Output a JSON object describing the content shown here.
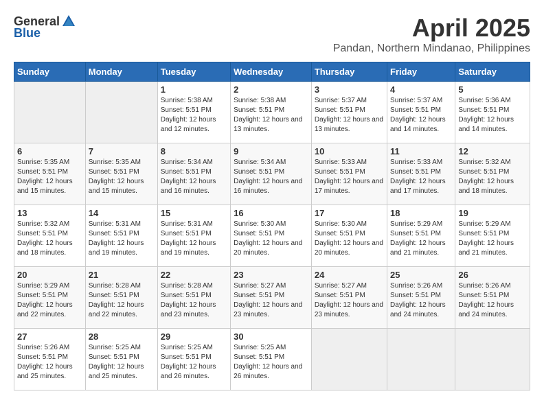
{
  "header": {
    "logo_general": "General",
    "logo_blue": "Blue",
    "month_year": "April 2025",
    "location": "Pandan, Northern Mindanao, Philippines"
  },
  "days_of_week": [
    "Sunday",
    "Monday",
    "Tuesday",
    "Wednesday",
    "Thursday",
    "Friday",
    "Saturday"
  ],
  "weeks": [
    [
      {
        "day": "",
        "info": ""
      },
      {
        "day": "",
        "info": ""
      },
      {
        "day": "1",
        "info": "Sunrise: 5:38 AM\nSunset: 5:51 PM\nDaylight: 12 hours and 12 minutes."
      },
      {
        "day": "2",
        "info": "Sunrise: 5:38 AM\nSunset: 5:51 PM\nDaylight: 12 hours and 13 minutes."
      },
      {
        "day": "3",
        "info": "Sunrise: 5:37 AM\nSunset: 5:51 PM\nDaylight: 12 hours and 13 minutes."
      },
      {
        "day": "4",
        "info": "Sunrise: 5:37 AM\nSunset: 5:51 PM\nDaylight: 12 hours and 14 minutes."
      },
      {
        "day": "5",
        "info": "Sunrise: 5:36 AM\nSunset: 5:51 PM\nDaylight: 12 hours and 14 minutes."
      }
    ],
    [
      {
        "day": "6",
        "info": "Sunrise: 5:35 AM\nSunset: 5:51 PM\nDaylight: 12 hours and 15 minutes."
      },
      {
        "day": "7",
        "info": "Sunrise: 5:35 AM\nSunset: 5:51 PM\nDaylight: 12 hours and 15 minutes."
      },
      {
        "day": "8",
        "info": "Sunrise: 5:34 AM\nSunset: 5:51 PM\nDaylight: 12 hours and 16 minutes."
      },
      {
        "day": "9",
        "info": "Sunrise: 5:34 AM\nSunset: 5:51 PM\nDaylight: 12 hours and 16 minutes."
      },
      {
        "day": "10",
        "info": "Sunrise: 5:33 AM\nSunset: 5:51 PM\nDaylight: 12 hours and 17 minutes."
      },
      {
        "day": "11",
        "info": "Sunrise: 5:33 AM\nSunset: 5:51 PM\nDaylight: 12 hours and 17 minutes."
      },
      {
        "day": "12",
        "info": "Sunrise: 5:32 AM\nSunset: 5:51 PM\nDaylight: 12 hours and 18 minutes."
      }
    ],
    [
      {
        "day": "13",
        "info": "Sunrise: 5:32 AM\nSunset: 5:51 PM\nDaylight: 12 hours and 18 minutes."
      },
      {
        "day": "14",
        "info": "Sunrise: 5:31 AM\nSunset: 5:51 PM\nDaylight: 12 hours and 19 minutes."
      },
      {
        "day": "15",
        "info": "Sunrise: 5:31 AM\nSunset: 5:51 PM\nDaylight: 12 hours and 19 minutes."
      },
      {
        "day": "16",
        "info": "Sunrise: 5:30 AM\nSunset: 5:51 PM\nDaylight: 12 hours and 20 minutes."
      },
      {
        "day": "17",
        "info": "Sunrise: 5:30 AM\nSunset: 5:51 PM\nDaylight: 12 hours and 20 minutes."
      },
      {
        "day": "18",
        "info": "Sunrise: 5:29 AM\nSunset: 5:51 PM\nDaylight: 12 hours and 21 minutes."
      },
      {
        "day": "19",
        "info": "Sunrise: 5:29 AM\nSunset: 5:51 PM\nDaylight: 12 hours and 21 minutes."
      }
    ],
    [
      {
        "day": "20",
        "info": "Sunrise: 5:29 AM\nSunset: 5:51 PM\nDaylight: 12 hours and 22 minutes."
      },
      {
        "day": "21",
        "info": "Sunrise: 5:28 AM\nSunset: 5:51 PM\nDaylight: 12 hours and 22 minutes."
      },
      {
        "day": "22",
        "info": "Sunrise: 5:28 AM\nSunset: 5:51 PM\nDaylight: 12 hours and 23 minutes."
      },
      {
        "day": "23",
        "info": "Sunrise: 5:27 AM\nSunset: 5:51 PM\nDaylight: 12 hours and 23 minutes."
      },
      {
        "day": "24",
        "info": "Sunrise: 5:27 AM\nSunset: 5:51 PM\nDaylight: 12 hours and 23 minutes."
      },
      {
        "day": "25",
        "info": "Sunrise: 5:26 AM\nSunset: 5:51 PM\nDaylight: 12 hours and 24 minutes."
      },
      {
        "day": "26",
        "info": "Sunrise: 5:26 AM\nSunset: 5:51 PM\nDaylight: 12 hours and 24 minutes."
      }
    ],
    [
      {
        "day": "27",
        "info": "Sunrise: 5:26 AM\nSunset: 5:51 PM\nDaylight: 12 hours and 25 minutes."
      },
      {
        "day": "28",
        "info": "Sunrise: 5:25 AM\nSunset: 5:51 PM\nDaylight: 12 hours and 25 minutes."
      },
      {
        "day": "29",
        "info": "Sunrise: 5:25 AM\nSunset: 5:51 PM\nDaylight: 12 hours and 26 minutes."
      },
      {
        "day": "30",
        "info": "Sunrise: 5:25 AM\nSunset: 5:51 PM\nDaylight: 12 hours and 26 minutes."
      },
      {
        "day": "",
        "info": ""
      },
      {
        "day": "",
        "info": ""
      },
      {
        "day": "",
        "info": ""
      }
    ]
  ]
}
